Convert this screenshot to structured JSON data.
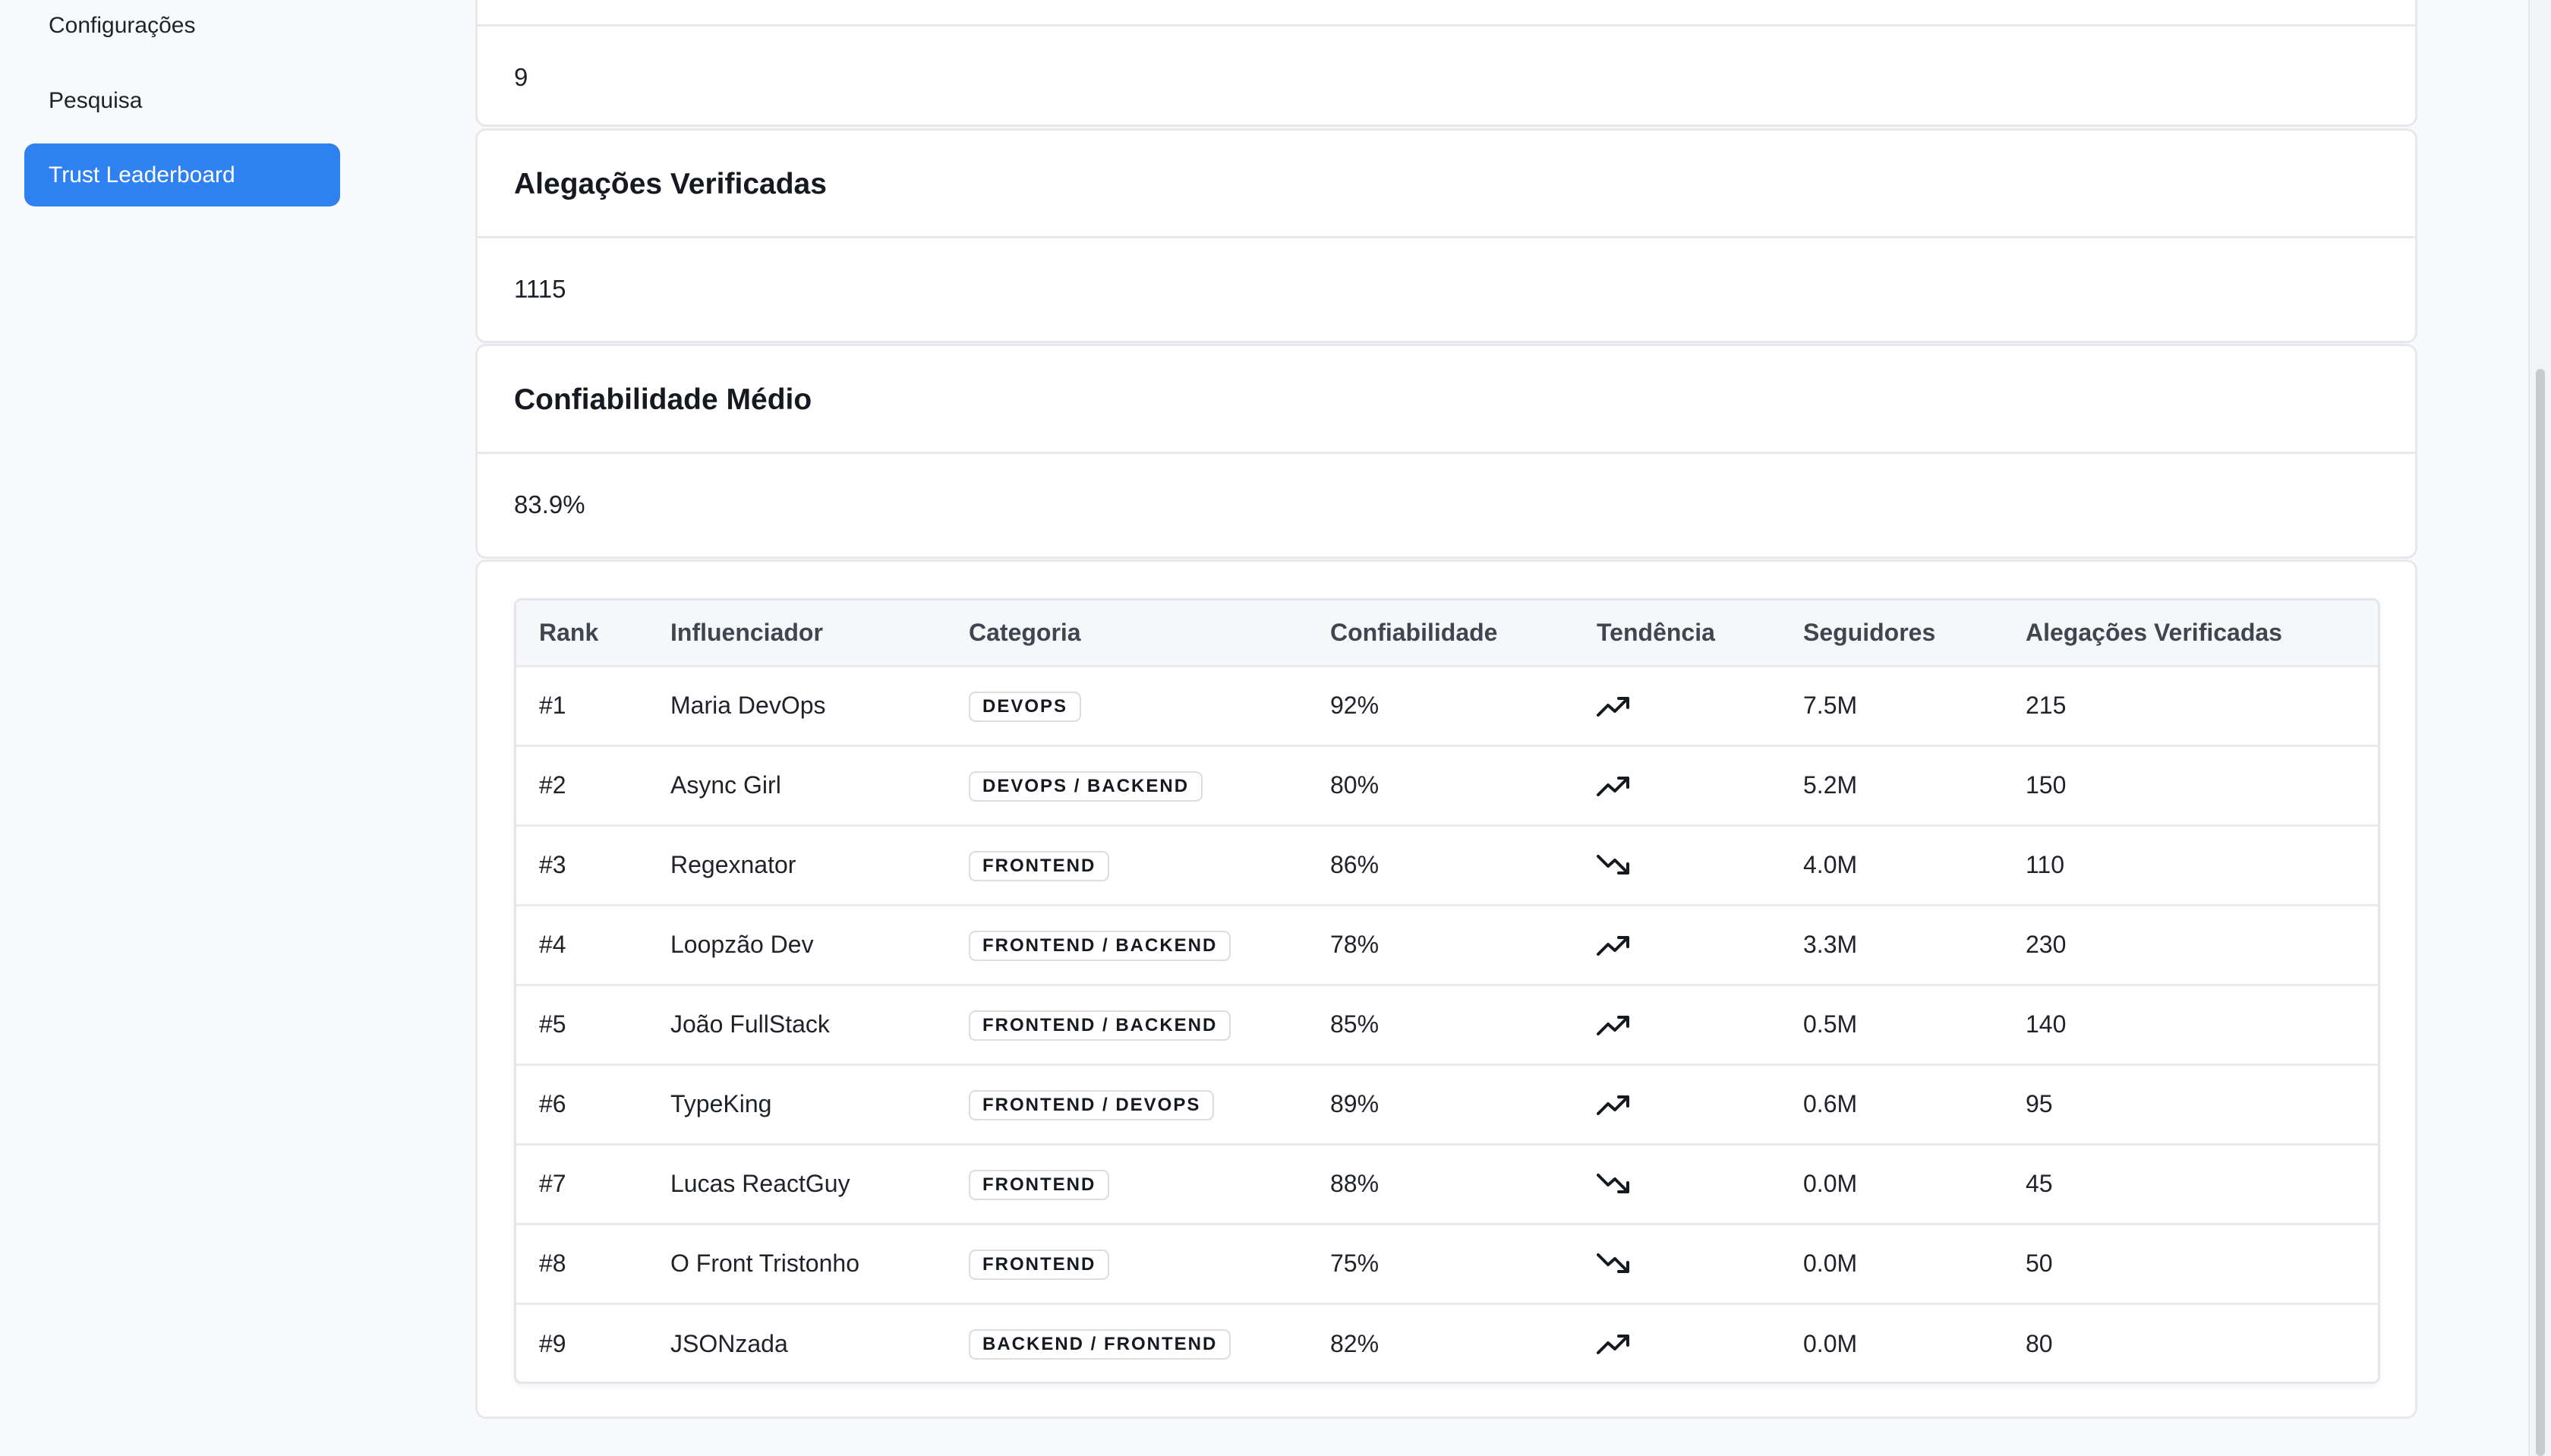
{
  "sidebar": {
    "items": [
      {
        "label": "Configurações"
      },
      {
        "label": "Pesquisa"
      },
      {
        "label": "Trust Leaderboard",
        "active": true
      }
    ]
  },
  "stats": {
    "top_value": "9",
    "verified_claims": {
      "title": "Alegações Verificadas",
      "value": "1115"
    },
    "avg_reliability": {
      "title": "Confiabilidade Médio",
      "value": "83.9%"
    }
  },
  "leaderboard": {
    "columns": [
      "Rank",
      "Influenciador",
      "Categoria",
      "Confiabilidade",
      "Tendência",
      "Seguidores",
      "Alegações Verificadas"
    ],
    "rows": [
      {
        "rank": "#1",
        "name": "Maria DevOps",
        "category": "DEVOPS",
        "reliability": "92%",
        "trend": "up",
        "followers": "7.5M",
        "claims": "215"
      },
      {
        "rank": "#2",
        "name": "Async Girl",
        "category": "DEVOPS / BACKEND",
        "reliability": "80%",
        "trend": "up",
        "followers": "5.2M",
        "claims": "150"
      },
      {
        "rank": "#3",
        "name": "Regexnator",
        "category": "FRONTEND",
        "reliability": "86%",
        "trend": "down",
        "followers": "4.0M",
        "claims": "110"
      },
      {
        "rank": "#4",
        "name": "Loopzão Dev",
        "category": "FRONTEND / BACKEND",
        "reliability": "78%",
        "trend": "up",
        "followers": "3.3M",
        "claims": "230"
      },
      {
        "rank": "#5",
        "name": "João FullStack",
        "category": "FRONTEND / BACKEND",
        "reliability": "85%",
        "trend": "up",
        "followers": "0.5M",
        "claims": "140"
      },
      {
        "rank": "#6",
        "name": "TypeKing",
        "category": "FRONTEND / DEVOPS",
        "reliability": "89%",
        "trend": "up",
        "followers": "0.6M",
        "claims": "95"
      },
      {
        "rank": "#7",
        "name": "Lucas ReactGuy",
        "category": "FRONTEND",
        "reliability": "88%",
        "trend": "down",
        "followers": "0.0M",
        "claims": "45"
      },
      {
        "rank": "#8",
        "name": "O Front Tristonho",
        "category": "FRONTEND",
        "reliability": "75%",
        "trend": "down",
        "followers": "0.0M",
        "claims": "50"
      },
      {
        "rank": "#9",
        "name": "JSONzada",
        "category": "BACKEND / FRONTEND",
        "reliability": "82%",
        "trend": "up",
        "followers": "0.0M",
        "claims": "80"
      }
    ]
  },
  "colors": {
    "accent": "#2f80f1",
    "background": "#f8f9fa",
    "border": "#e6e8eb"
  }
}
